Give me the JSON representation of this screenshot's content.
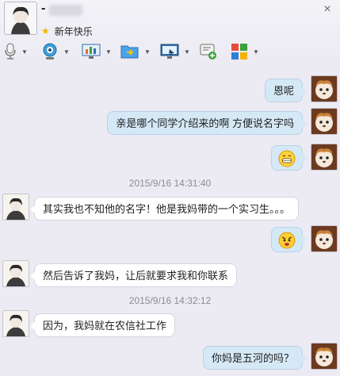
{
  "header": {
    "name_prefix": "-",
    "signature": "新年快乐",
    "close_symbol": "×"
  },
  "toolbar": {
    "tools": [
      {
        "icon": "microphone-icon"
      },
      {
        "icon": "webcam-icon"
      },
      {
        "icon": "screen-share-icon"
      },
      {
        "icon": "send-file-icon"
      },
      {
        "icon": "remote-desktop-icon"
      },
      {
        "icon": "new-chat-icon"
      },
      {
        "icon": "apps-icon"
      }
    ]
  },
  "messages": [
    {
      "side": "right",
      "text": "恩呢"
    },
    {
      "side": "right",
      "text": "亲是哪个同学介绍来的啊 方便说名字吗"
    },
    {
      "side": "right",
      "emoji": "grin-emoji"
    },
    {
      "timestamp": "2015/9/16 14:31:40"
    },
    {
      "side": "left",
      "text": "其实我也不知他的名字！他是我妈带的一个实习生。。。"
    },
    {
      "side": "right",
      "emoji": "angry-emoji"
    },
    {
      "side": "left",
      "text": "然后告诉了我妈，让后就要求我和你联系"
    },
    {
      "timestamp": "2015/9/16 14:32:12"
    },
    {
      "side": "left",
      "text": "因为，我妈就在农信社工作"
    },
    {
      "side": "right",
      "text": "你妈是五河的吗？"
    }
  ],
  "colors": {
    "bubble_right": "#d5e8f6",
    "bubble_left": "#ffffff",
    "background": "#eceaf3"
  }
}
